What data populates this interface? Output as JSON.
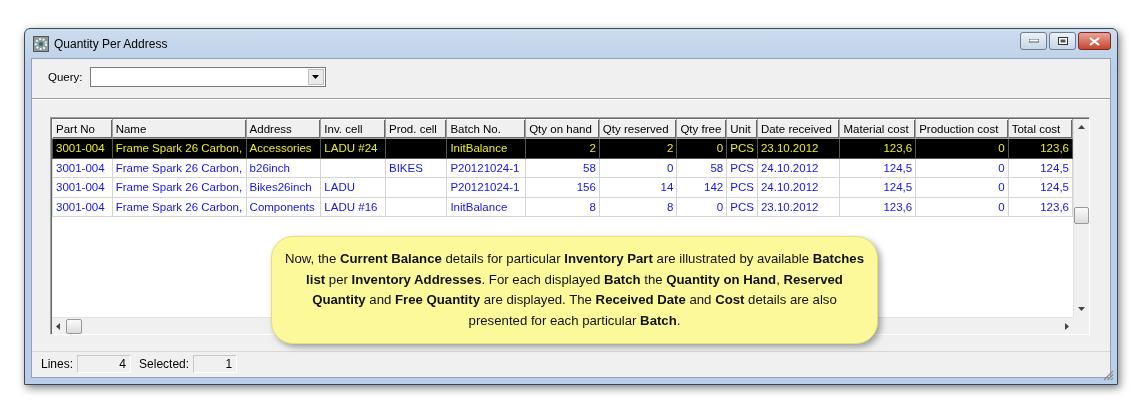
{
  "window": {
    "title": "Quantity Per Address"
  },
  "query": {
    "label": "Query:"
  },
  "table": {
    "columns": [
      {
        "label": "Part No",
        "kind": "text"
      },
      {
        "label": "Name",
        "kind": "text"
      },
      {
        "label": "Address",
        "kind": "text"
      },
      {
        "label": "Inv. cell",
        "kind": "text"
      },
      {
        "label": "Prod. cell",
        "kind": "text"
      },
      {
        "label": "Batch No.",
        "kind": "text"
      },
      {
        "label": "Qty on hand",
        "kind": "number"
      },
      {
        "label": "Qty reserved",
        "kind": "number"
      },
      {
        "label": "Qty free",
        "kind": "number"
      },
      {
        "label": "Unit",
        "kind": "text"
      },
      {
        "label": "Date received",
        "kind": "text"
      },
      {
        "label": "Material cost",
        "kind": "number"
      },
      {
        "label": "Production cost",
        "kind": "number"
      },
      {
        "label": "Total cost",
        "kind": "number"
      }
    ],
    "rows": [
      {
        "selected": true,
        "cells": [
          "3001-004",
          "Frame Spark 26 Carbon,",
          "Accessories",
          "LADU #24",
          "",
          "InitBalance",
          "2",
          "2",
          "0",
          "PCS",
          "23.10.2012",
          "123,6",
          "0",
          "123,6"
        ]
      },
      {
        "selected": false,
        "cells": [
          "3001-004",
          "Frame Spark 26 Carbon,",
          "b26inch",
          "",
          "BIKES",
          "P20121024-1",
          "58",
          "0",
          "58",
          "PCS",
          "24.10.2012",
          "124,5",
          "0",
          "124,5"
        ]
      },
      {
        "selected": false,
        "cells": [
          "3001-004",
          "Frame Spark 26 Carbon,",
          "Bikes26inch",
          "LADU",
          "",
          "P20121024-1",
          "156",
          "14",
          "142",
          "PCS",
          "24.10.2012",
          "124,5",
          "0",
          "124,5"
        ]
      },
      {
        "selected": false,
        "cells": [
          "3001-004",
          "Frame Spark 26 Carbon,",
          "Components",
          "LADU #16",
          "",
          "InitBalance",
          "8",
          "8",
          "0",
          "PCS",
          "23.10.2012",
          "123,6",
          "0",
          "123,6"
        ]
      }
    ]
  },
  "status_bar": {
    "fields": [
      {
        "label": "Lines:",
        "value": "4"
      },
      {
        "label": "Selected:",
        "value": "1"
      }
    ]
  },
  "callout": {
    "text": "Now, the **Current Balance** details for particular **Inventory Part** are illustrated by available **Batches list** per **Inventory Addresses**.  For each displayed **Batch** the **Quantity on Hand**, **Reserved Quantity** and **Free Quantity** are displayed.  The **Received Date** and **Cost** details are also presented for each particular **Batch**."
  }
}
